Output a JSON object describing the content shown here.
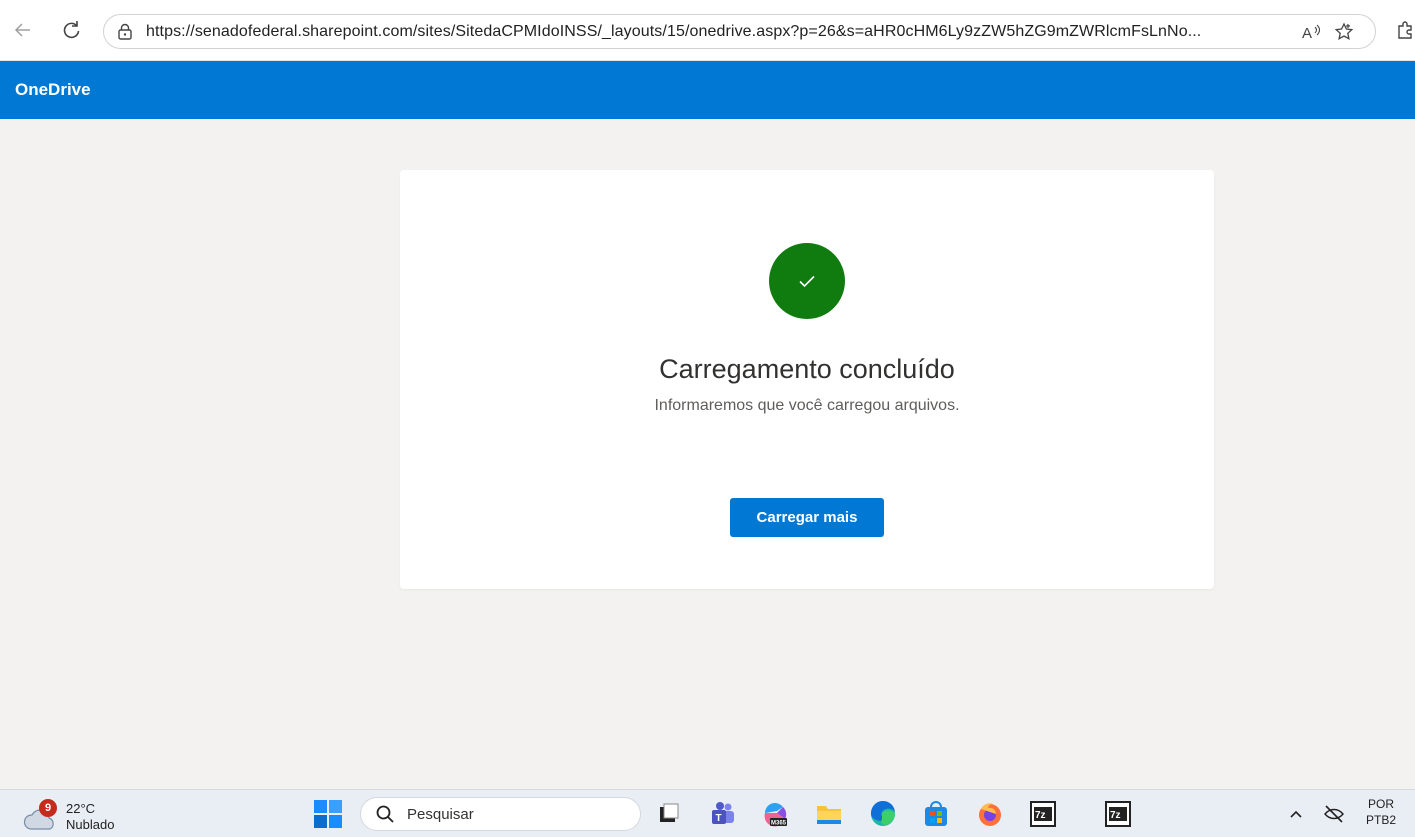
{
  "browser": {
    "url": "https://senadofederal.sharepoint.com/sites/SitedaCPMIdoINSS/_layouts/15/onedrive.aspx?p=26&s=aHR0cHM6Ly9zZW5hZG9mZWRlcmFsLnNo...",
    "icons": [
      "back-icon",
      "refresh-icon",
      "site-info-icon",
      "read-aloud-icon",
      "favorite-star-icon",
      "extensions-icon"
    ]
  },
  "app": {
    "title": "OneDrive",
    "accent": "#0078d4"
  },
  "upload": {
    "title": "Carregamento concluído",
    "subtitle": "Informaremos que você carregou arquivos.",
    "button_label": "Carregar mais",
    "success_color": "#107c10"
  },
  "taskbar": {
    "weather_badge": "9",
    "temperature": "22°C",
    "weather_desc": "Nublado",
    "search_placeholder": "Pesquisar",
    "apps": [
      "task-view-icon",
      "teams-icon",
      "m365-icon",
      "file-explorer-icon",
      "edge-icon",
      "store-icon",
      "firefox-icon",
      "7zip-icon",
      "7zip-icon"
    ],
    "app_7z_label": "7z",
    "m365_label": "M365",
    "lang_line1": "POR",
    "lang_line2": "PTB2"
  }
}
